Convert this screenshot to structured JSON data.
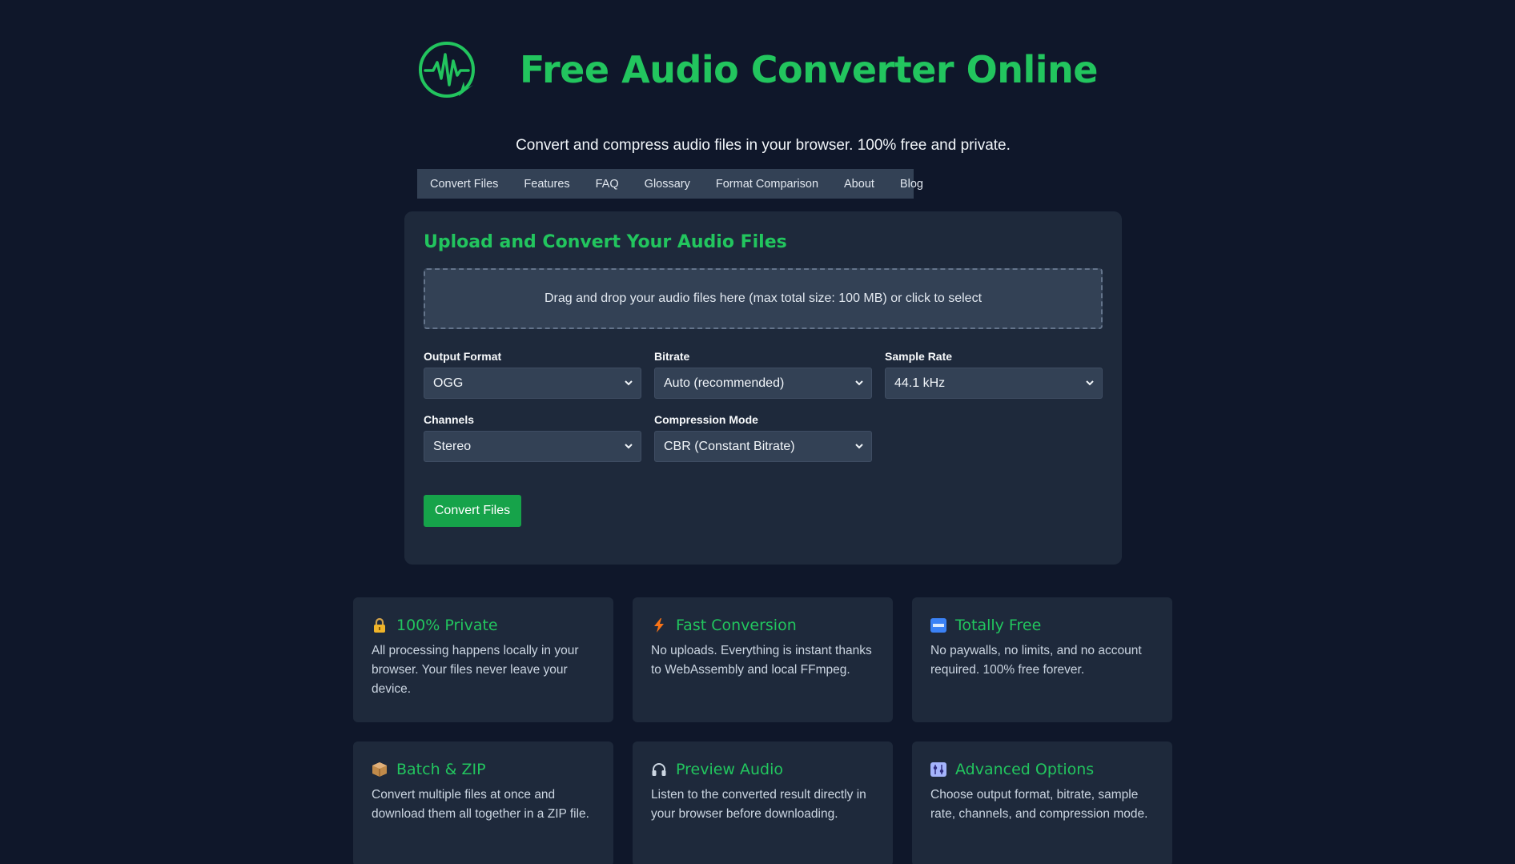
{
  "header": {
    "title": "Free Audio Converter Online",
    "subtitle": "Convert and compress audio files in your browser. 100% free and private."
  },
  "nav": {
    "items": [
      "Convert Files",
      "Features",
      "FAQ",
      "Glossary",
      "Format Comparison",
      "About",
      "Blog"
    ]
  },
  "converter": {
    "title": "Upload and Convert Your Audio Files",
    "dropzone_text": "Drag and drop your audio files here (max total size: 100 MB) or click to select",
    "fields": {
      "output_format": {
        "label": "Output Format",
        "value": "OGG"
      },
      "bitrate": {
        "label": "Bitrate",
        "value": "Auto (recommended)"
      },
      "sample_rate": {
        "label": "Sample Rate",
        "value": "44.1 kHz"
      },
      "channels": {
        "label": "Channels",
        "value": "Stereo"
      },
      "compression_mode": {
        "label": "Compression Mode",
        "value": "CBR (Constant Bitrate)"
      }
    },
    "convert_label": "Convert Files"
  },
  "features": [
    {
      "icon": "lock-icon",
      "title": "100% Private",
      "text": "All processing happens locally in your browser. Your files never leave your device."
    },
    {
      "icon": "lightning-icon",
      "title": "Fast Conversion",
      "text": "No uploads. Everything is instant thanks to WebAssembly and local FFmpeg."
    },
    {
      "icon": "free-badge-icon",
      "title": "Totally Free",
      "text": "No paywalls, no limits, and no account required. 100% free forever."
    },
    {
      "icon": "package-icon",
      "title": "Batch & ZIP",
      "text": "Convert multiple files at once and download them all together in a ZIP file."
    },
    {
      "icon": "headphones-icon",
      "title": "Preview Audio",
      "text": "Listen to the converted result directly in your browser before downloading."
    },
    {
      "icon": "control-knobs-icon",
      "title": "Advanced Options",
      "text": "Choose output format, bitrate, sample rate, channels, and compression mode."
    }
  ],
  "colors": {
    "background": "#0f172a",
    "panel": "#1e293b",
    "accent": "#22c55e",
    "button": "#16a34a",
    "nav": "#334155"
  }
}
